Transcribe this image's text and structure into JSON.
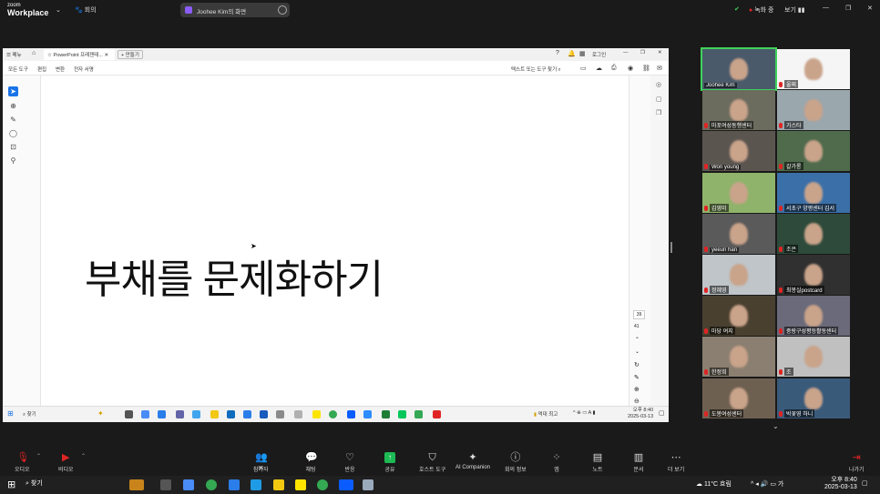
{
  "zoom": {
    "brand_top": "zoom",
    "brand_bottom": "Workplace",
    "meeting_label": "회의",
    "share_tab_label": "Joohee Kim의 화면",
    "recording_label": "녹화 중",
    "view_label": "보기"
  },
  "shared_window": {
    "menu_label": "메뉴",
    "tab_label": "PowerPoint 프레젠테...",
    "new_tab_label": "+ 만들기",
    "login_label": "로그인",
    "menu_items": [
      "모든 도구",
      "편집",
      "변환",
      "전자 서명"
    ],
    "search_tools_label": "텍스트 또는 도구 찾기",
    "slide_text": "부채를 문제화하기",
    "page_current": "39",
    "page_total": "41",
    "taskbar": {
      "search_label": "찾기",
      "weather_label": "먹대 최고",
      "time": "오후 8:40",
      "date": "2025-03-13"
    }
  },
  "participants": [
    {
      "name": "Joohee Kim",
      "active": true
    },
    {
      "name": "울찌",
      "active": false
    },
    {
      "name": "마포여성동행센터",
      "active": false
    },
    {
      "name": "가스타",
      "active": false
    },
    {
      "name": "Won young",
      "active": false
    },
    {
      "name": "갈가롱",
      "active": false
    },
    {
      "name": "김영미",
      "active": false
    },
    {
      "name": "서초구 양평센터 김서",
      "active": false
    },
    {
      "name": "yeeun han",
      "active": false
    },
    {
      "name": "조은",
      "active": false
    },
    {
      "name": "정혜영",
      "active": false
    },
    {
      "name": "최봉실postcard",
      "active": false
    },
    {
      "name": "마당 여지",
      "active": false
    },
    {
      "name": "중랑구성평등활동센터",
      "active": false
    },
    {
      "name": "한정희",
      "active": false
    },
    {
      "name": "조",
      "active": false
    },
    {
      "name": "도봉여성센터",
      "active": false
    },
    {
      "name": "박꽃영 하니",
      "active": false
    }
  ],
  "toolbar": {
    "audio": "오디오",
    "video": "비디오",
    "participants": "참가자",
    "participant_count": "96",
    "chat": "채팅",
    "react": "반응",
    "share": "공유",
    "host_tools": "호스트 도구",
    "ai": "AI Companion",
    "info": "회의 정보",
    "apps": "앱",
    "notes": "노트",
    "docs": "문서",
    "more": "더 보기",
    "leave": "나가기"
  },
  "windows": {
    "search_label": "찾기",
    "weather": "11°C 흐림",
    "time": "오후 8:40",
    "date": "2025-03-13",
    "ime": "가"
  },
  "colors": {
    "active_border": "#3fd35a",
    "record_dot": "#e02424",
    "share_green": "#1db954",
    "leave_red": "#e02424"
  }
}
